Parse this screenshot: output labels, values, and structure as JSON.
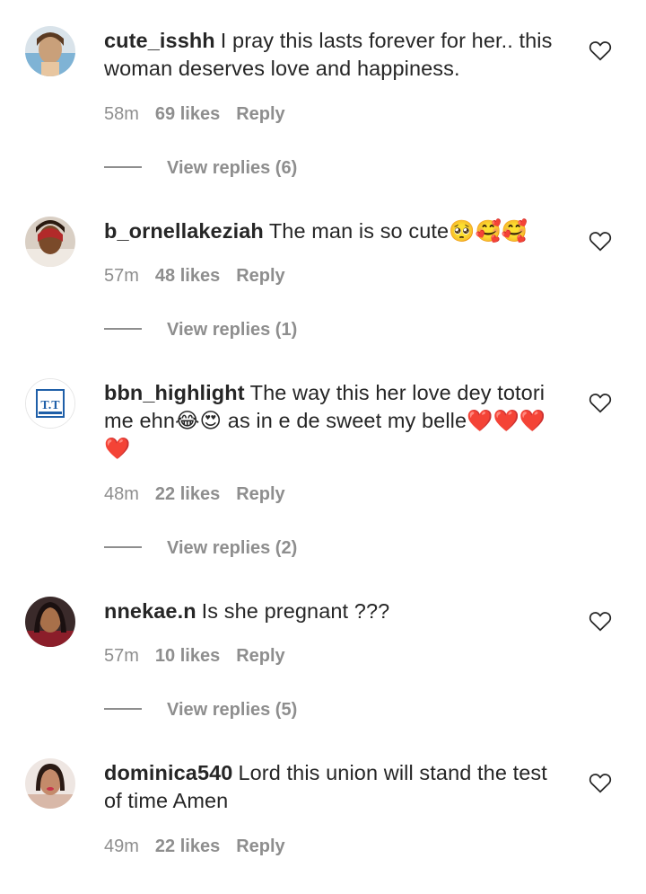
{
  "comments": [
    {
      "username": "cute_isshh",
      "text": "I pray this lasts forever for her.. this woman deserves love and happiness.",
      "time": "58m",
      "likes": "69 likes",
      "reply": "Reply",
      "view_replies": "View replies (6)",
      "avatar_color": "#c9a07a"
    },
    {
      "username": "b_ornellakeziah",
      "text": "The man is so cute🥺🥰🥰",
      "time": "57m",
      "likes": "48 likes",
      "reply": "Reply",
      "view_replies": "View replies (1)",
      "avatar_color": "#7a4a2a"
    },
    {
      "username": "bbn_highlight",
      "text": "The way this her love dey totori me ehn😂😍 as in e de sweet my belle❤️❤️❤️❤️",
      "time": "48m",
      "likes": "22 likes",
      "reply": "Reply",
      "view_replies": "View replies (2)",
      "avatar_text": "T.T",
      "avatar_color": "#1f5fa8"
    },
    {
      "username": "nnekae.n",
      "text": "Is she pregnant ???",
      "time": "57m",
      "likes": "10 likes",
      "reply": "Reply",
      "view_replies": "View replies (5)",
      "avatar_color": "#8b1e2a"
    },
    {
      "username": "dominica540",
      "text": "Lord this union will stand the test of time Amen",
      "time": "49m",
      "likes": "22 likes",
      "reply": "Reply",
      "avatar_color": "#d8b8a8"
    }
  ]
}
